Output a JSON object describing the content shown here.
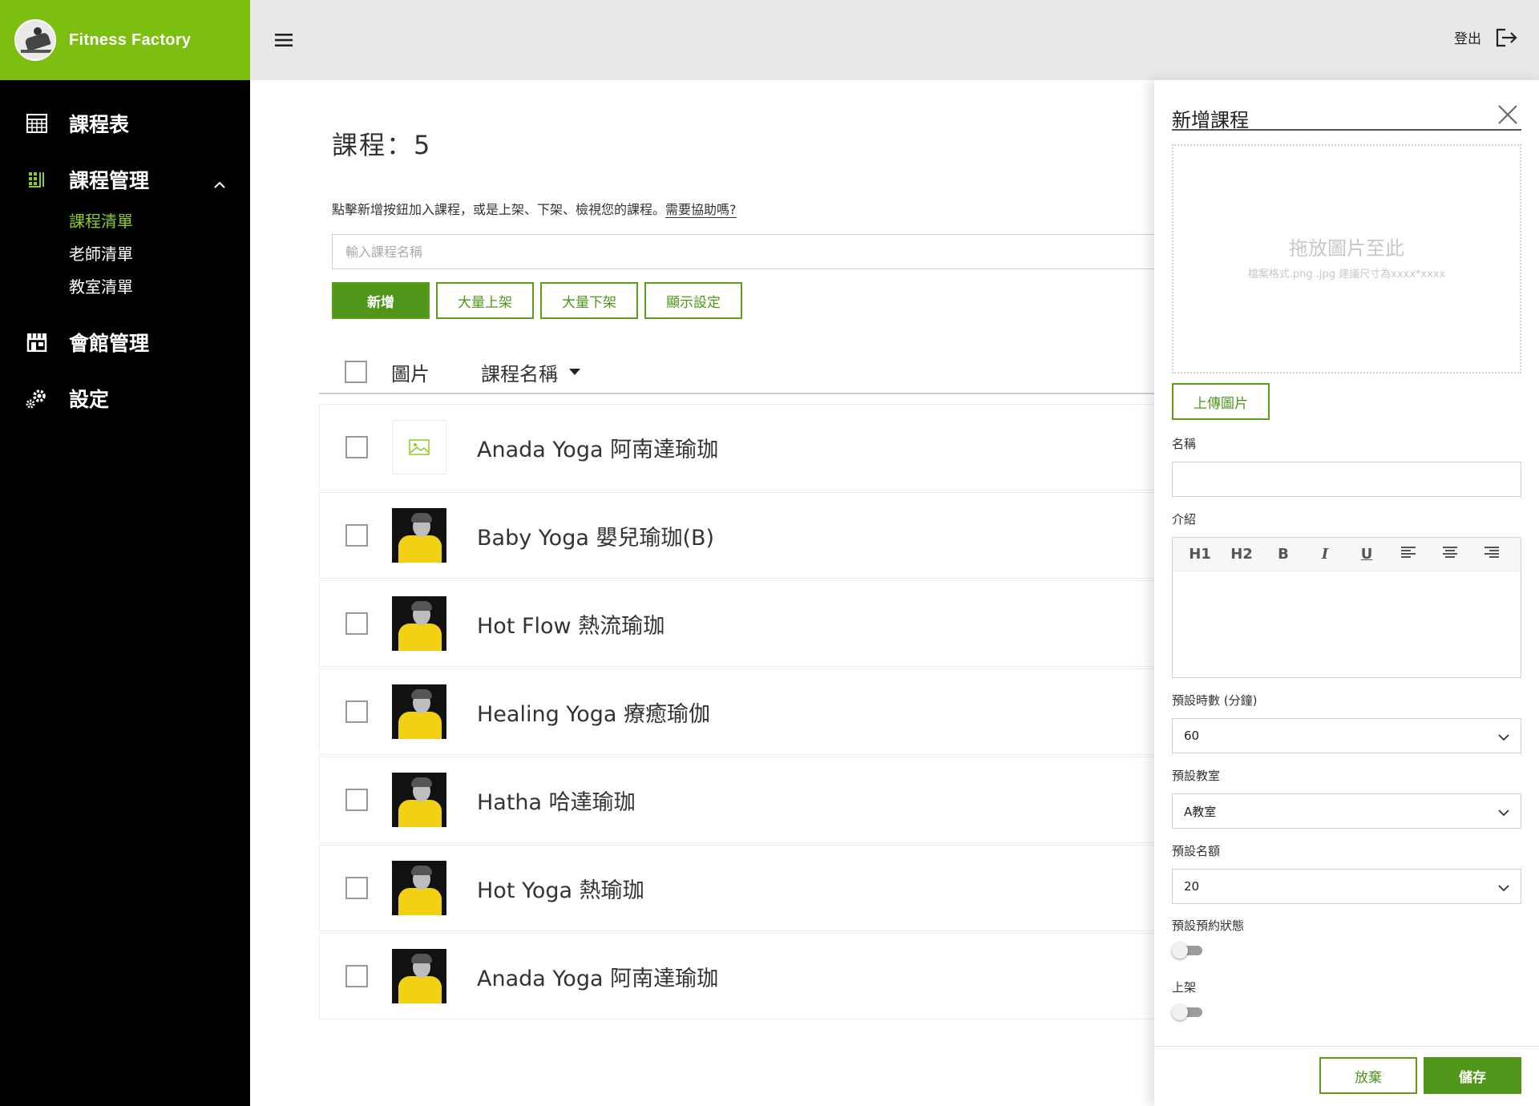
{
  "brand": {
    "name": "Fitness Factory"
  },
  "sidebar": {
    "items": [
      {
        "label": "課程表",
        "icon": "calendar-icon"
      },
      {
        "label": "課程管理",
        "icon": "course-icon",
        "expanded": true,
        "children": [
          {
            "label": "課程清單",
            "current": true
          },
          {
            "label": "老師清單"
          },
          {
            "label": "教室清單"
          }
        ]
      },
      {
        "label": "會館管理",
        "icon": "store-icon"
      },
      {
        "label": "設定",
        "icon": "gear-icon"
      }
    ]
  },
  "topbar": {
    "logout_label": "登出"
  },
  "main": {
    "title": "課程：5",
    "hint_text": "點擊新增按鈕加入課程，或是上架、下架、檢視您的課程。",
    "help_link": "需要協助嗎?",
    "search_placeholder": "輸入課程名稱",
    "buttons": {
      "add": "新增",
      "bulk_on": "大量上架",
      "bulk_off": "大量下架",
      "display": "顯示設定"
    },
    "columns": {
      "picture": "圖片",
      "name": "課程名稱"
    },
    "rows": [
      {
        "name": "Anada Yoga 阿南達瑜珈",
        "has_image": false
      },
      {
        "name": "Baby Yoga 嬰兒瑜珈(B)",
        "has_image": true
      },
      {
        "name": "Hot Flow 熱流瑜珈",
        "has_image": true
      },
      {
        "name": "Healing Yoga 療癒瑜伽",
        "has_image": true
      },
      {
        "name": "Hatha 哈達瑜珈",
        "has_image": true
      },
      {
        "name": "Hot Yoga 熱瑜珈",
        "has_image": true
      },
      {
        "name": "Anada Yoga 阿南達瑜珈",
        "has_image": true
      }
    ]
  },
  "drawer": {
    "title": "新增課程",
    "drop_title": "拖放圖片至此",
    "drop_hint": "檔案格式.png .jpg 建議尺寸為xxxx*xxxx",
    "upload_label": "上傳圖片",
    "name_label": "名稱",
    "name_value": "",
    "intro_label": "介紹",
    "toolbar": [
      "H1",
      "H2",
      "B",
      "I",
      "U"
    ],
    "duration_label": "預設時數 (分鐘)",
    "duration_value": "60",
    "room_label": "預設教室",
    "room_value": "A教室",
    "quota_label": "預設名額",
    "quota_value": "20",
    "booking_status_label": "預設預約狀態",
    "booking_status_on": false,
    "publish_label": "上架",
    "publish_on": false,
    "cancel_label": "放棄",
    "save_label": "儲存"
  },
  "colors": {
    "brand_green": "#7cbf11",
    "accent_green": "#4f961a",
    "active_nav": "#8ccd21"
  }
}
